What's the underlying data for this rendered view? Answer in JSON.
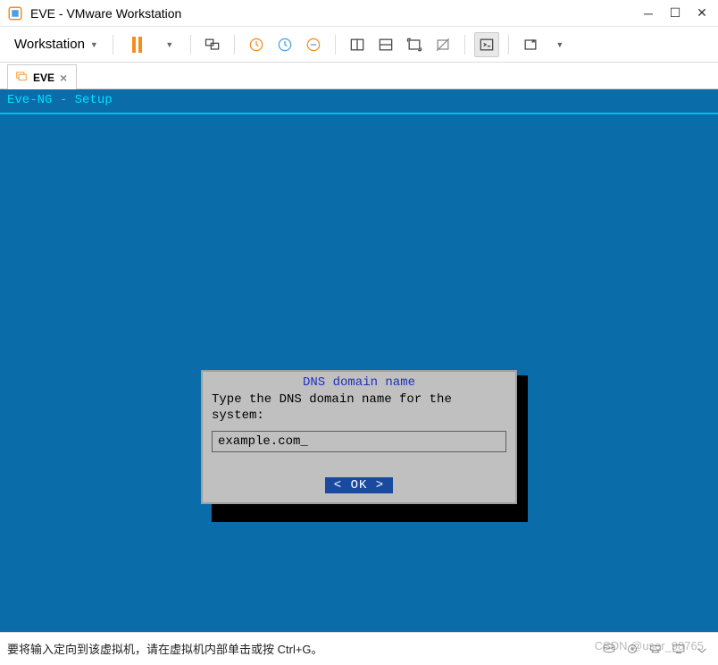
{
  "window": {
    "title": "EVE - VMware Workstation"
  },
  "toolbar": {
    "menu_label": "Workstation"
  },
  "tab": {
    "label": "EVE"
  },
  "vm": {
    "header": "Eve-NG - Setup",
    "dialog": {
      "title": "DNS domain name",
      "prompt": "Type the DNS domain name for the\nsystem:",
      "input_value": "example.com_",
      "ok_label": "<  OK  >"
    }
  },
  "statusbar": {
    "hint": "要将输入定向到该虚拟机，请在虚拟机内部单击或按 Ctrl+G。"
  },
  "watermark": "CSDN @user_98765"
}
